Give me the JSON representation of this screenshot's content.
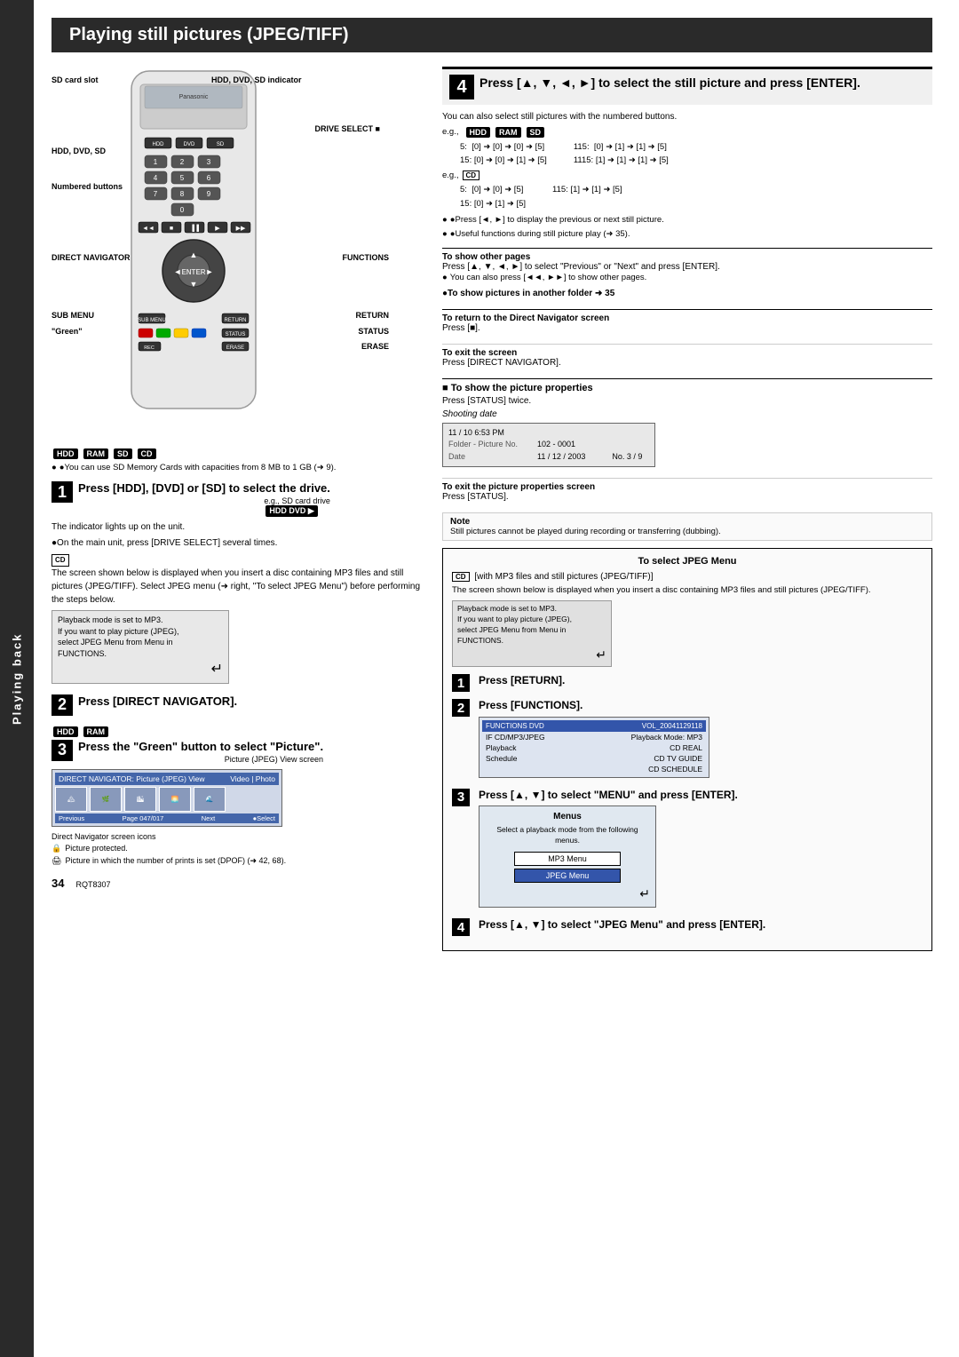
{
  "page": {
    "title": "Playing still pictures (JPEG/TIFF)",
    "sidebar_label": "Playing back",
    "page_number": "34",
    "page_code": "RQT8307"
  },
  "remote_labels": {
    "sd_card_slot": "SD card slot",
    "hdd_dvd_sd_indicator": "HDD, DVD, SD indicator",
    "drive_select": "DRIVE SELECT ■",
    "hdd_dvd_sd": "HDD, DVD, SD",
    "numbered_buttons": "Numbered buttons",
    "direct_navigator": "DIRECT NAVIGATOR",
    "functions": "FUNCTIONS",
    "sub_menu": "SUB MENU",
    "return": "RETURN",
    "green": "\"Green\"",
    "status": "STATUS",
    "erase": "ERASE"
  },
  "hdd_ram_note": "●You can use SD Memory Cards with capacities from 8 MB to 1 GB (➜ 9).",
  "step1": {
    "number": "1",
    "title": "Press [HDD], [DVD] or [SD] to select the drive.",
    "example": "e.g., SD card drive",
    "badge": "HDD DVD SD",
    "note1": "The indicator lights up on the unit.",
    "note2": "●On the main unit, press [DRIVE SELECT] several times.",
    "cd_note": "The screen shown below is displayed when you insert a disc containing MP3 files and still pictures (JPEG/TIFF). Select JPEG menu (➜ right, \"To select JPEG Menu\") before performing the steps below.",
    "screen_text1": "Playback mode is set to MP3.",
    "screen_text2": "If you want to play picture (JPEG),",
    "screen_text3": "select JPEG Menu from Menu in FUNCTIONS."
  },
  "step2": {
    "number": "2",
    "title": "Press [DIRECT NAVIGATOR]."
  },
  "step3": {
    "number": "3",
    "hdd_ram": "HDD RAM",
    "title": "Press the \"Green\" button to select \"Picture\".",
    "screen_caption": "Picture (JPEG) View screen",
    "screen_header": "DIRECT NAVIGATOR: Picture (JPEG) View",
    "footer_left": "Previous",
    "footer_page": "Page 047/017",
    "footer_next": "Next",
    "footer_action": "●Select",
    "icons_caption": "Direct Navigator screen icons",
    "icon1": "Picture protected.",
    "icon2": "Picture in which the number of prints is set (DPOF) (➜ 42, 68)."
  },
  "step4_main": {
    "number": "4",
    "title": "Press [▲, ▼, ◄, ►] to select the still picture and press [ENTER].",
    "note_numbered": "You can also select still pictures with the numbered buttons.",
    "eg_label": "e.g.,",
    "hdd_ram_sd": "HDD RAM SD",
    "table1": [
      {
        "row": "5:",
        "val": "[0] ➜ [0] ➜ [0] ➜ [5]"
      },
      {
        "row": "15:",
        "val": "[0] ➜ [0] ➜ [1] ➜ [5]"
      }
    ],
    "table1_right": [
      {
        "row": "115:",
        "val": "[0] ➜ [1] ➜ [1] ➜ [5]"
      },
      {
        "row": "1115:",
        "val": "[1] ➜ [1] ➜ [1] ➜ [5]"
      }
    ],
    "eg2_label": "e.g.,",
    "cd_label": "CD",
    "table2": [
      {
        "row": "5:",
        "val": "[0] ➜ [0] ➜ [5]"
      },
      {
        "row": "15:",
        "val": "[0] ➜ [1] ➜ [5]"
      }
    ],
    "table2_right": [
      {
        "row": "115:",
        "val": "[1] ➜ [1] ➜ [5]"
      }
    ],
    "press_note": "●Press [◄, ►] to display the previous or next still picture.",
    "useful_note": "●Useful functions during still picture play (➜ 35).",
    "to_show_other_pages": "To show other pages",
    "show_pages_text": "Press [▲, ▼, ◄, ►] to select \"Previous\" or \"Next\" and press [ENTER].",
    "show_pages_note": "●You can also press [◄◄, ►►] to show other pages.",
    "to_show_pictures_in_folder": "●To show pictures in another folder ➜ 35"
  },
  "right_col": {
    "return_section": {
      "title": "To return to the Direct Navigator screen",
      "text": "Press [■]."
    },
    "exit_section": {
      "title": "To exit the screen",
      "text": "Press [DIRECT NAVIGATOR]."
    },
    "show_props_section": {
      "title": "■ To show the picture properties",
      "subtitle": "Press [STATUS] twice.",
      "shooting_date": "Shooting date",
      "screen": {
        "row1_label": "11 / 10  6:53 PM",
        "row2_label": "Folder - Picture No.",
        "row2_val": "102 - 0001",
        "row3_label": "Date",
        "row3_val": "11 / 12 / 2003",
        "row3_extra": "No. 3 / 9"
      }
    },
    "exit_props_section": {
      "title": "To exit the picture properties screen",
      "text": "Press [STATUS]."
    },
    "note_section": {
      "title": "Note",
      "text": "Still pictures cannot be played during recording or transferring (dubbing)."
    },
    "jpeg_menu_section": {
      "box_title": "To select JPEG Menu",
      "cd_label": "CD",
      "cd_desc": "[with MP3 files and still pictures (JPEG/TIFF)]",
      "desc": "The screen shown below is displayed when you insert a disc containing MP3 files and still pictures (JPEG/TIFF).",
      "screen_text1": "Playback mode is set to MP3.",
      "screen_text2": "If you want to play picture (JPEG),",
      "screen_text3": "select JPEG Menu from Menu in FUNCTIONS.",
      "step1_title": "Press [RETURN].",
      "step2_title": "Press [FUNCTIONS].",
      "func_screen": {
        "header_left": "FUNCTIONS  DVD",
        "header_right": "VOL_20041129118",
        "subheader": "IF CD/MP3/JPEG",
        "subheader_right": "Playback Mode: MP3",
        "row1_label": "Playback",
        "row1_val": "CD REAL",
        "row2_label": "Schedule",
        "row2_val": "CD TV GUIDE",
        "row3_val": "CD SCHEDULE"
      },
      "step3_title": "Press [▲, ▼] to select \"MENU\" and press [ENTER].",
      "menu_screen": {
        "title": "Menus",
        "text": "Select a playback mode from the following menus.",
        "item1": "MP3 Menu",
        "item2": "JPEG Menu"
      },
      "step4_title": "Press [▲, ▼] to select \"JPEG Menu\" and press [ENTER]."
    }
  }
}
